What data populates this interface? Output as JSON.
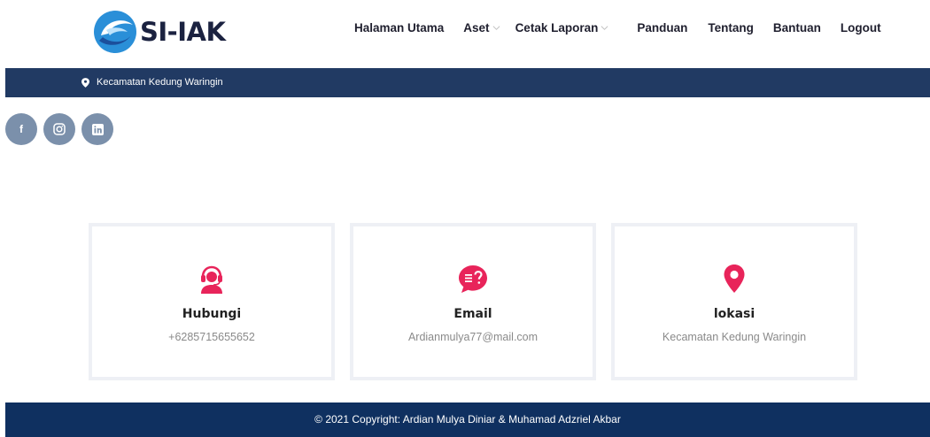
{
  "brand": {
    "name": "SI-IAK",
    "accent": "#e8245a",
    "navy": "#213a63"
  },
  "nav": {
    "items": [
      {
        "label": "Halaman Utama",
        "dropdown": false
      },
      {
        "label": "Aset",
        "dropdown": true
      },
      {
        "label": "Cetak Laporan",
        "dropdown": true
      },
      {
        "label": "Panduan",
        "dropdown": false
      },
      {
        "label": "Tentang",
        "dropdown": false
      },
      {
        "label": "Bantuan",
        "dropdown": false
      },
      {
        "label": "Logout",
        "dropdown": false
      }
    ]
  },
  "topbar": {
    "location": "Kecamatan Kedung Waringin",
    "icon": "map-pin-icon"
  },
  "social": [
    {
      "name": "facebook",
      "glyph": "f",
      "icon": "facebook-icon"
    },
    {
      "name": "instagram",
      "icon": "instagram-icon"
    },
    {
      "name": "linkedin",
      "icon": "linkedin-icon"
    }
  ],
  "cards": [
    {
      "title": "Hubungi",
      "value": "+6285715655652",
      "icon": "headset-agent-icon"
    },
    {
      "title": "Email",
      "value": "Ardianmulya77@mail.com",
      "icon": "chat-question-icon"
    },
    {
      "title": "lokasi",
      "value": "Kecamatan Kedung Waringin",
      "icon": "map-pin-icon"
    }
  ],
  "footer": {
    "copyright": "© 2021 Copyright: Ardian Mulya Diniar & Muhamad Adzriel Akbar"
  }
}
